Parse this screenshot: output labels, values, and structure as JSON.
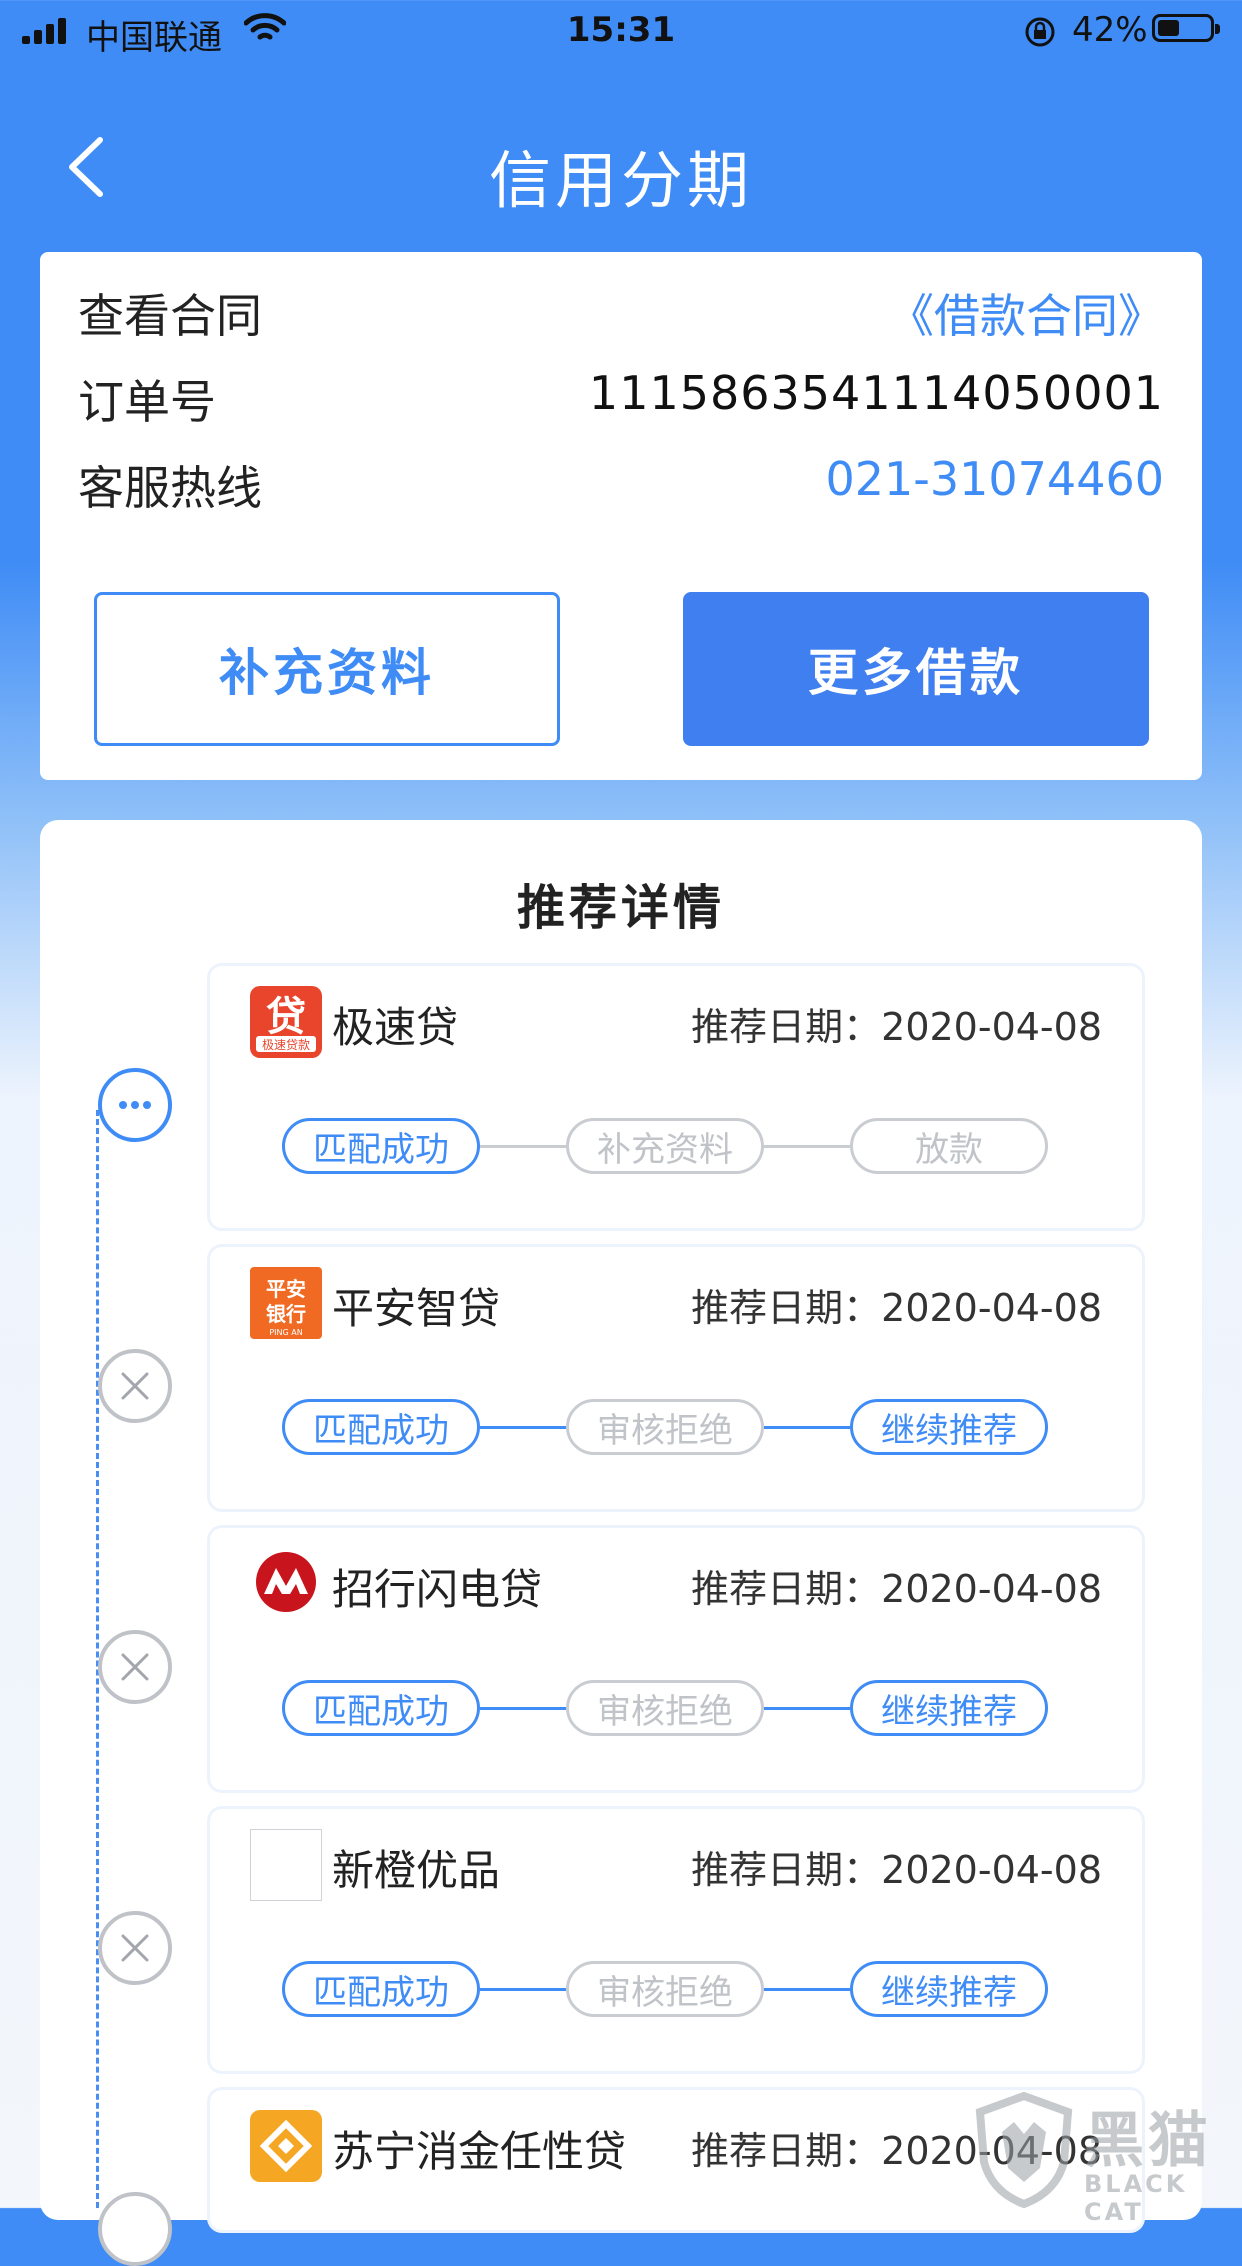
{
  "status_bar": {
    "carrier": "中国联通",
    "time": "15:31",
    "battery_percent": "42%",
    "battery_level": 0.42
  },
  "nav": {
    "back_icon": "chevron-left-icon",
    "title": "信用分期"
  },
  "info": {
    "contract_label": "查看合同",
    "contract_link": "《借款合同》",
    "order_label": "订单号",
    "order_number": "1115863541114050001",
    "hotline_label": "客服热线",
    "hotline_number": "021-31074460",
    "supplement_button": "补充资料",
    "more_loans_button": "更多借款"
  },
  "recommend": {
    "title": "推荐详情",
    "items": [
      {
        "name": "极速贷",
        "logo_icon": "jisudai-logo-icon",
        "logo_text": "贷",
        "logo_subtext": "极速贷款",
        "date": "推荐日期：2020-04-08",
        "node_icon": "pending-dots-icon",
        "steps": [
          "匹配成功",
          "补充资料",
          "放款"
        ]
      },
      {
        "name": "平安智贷",
        "logo_icon": "pingan-bank-logo-icon",
        "logo_text": "平安银行",
        "logo_subtext": "PING AN",
        "date": "推荐日期：2020-04-08",
        "node_icon": "rejected-x-icon",
        "steps": [
          "匹配成功",
          "审核拒绝",
          "继续推荐"
        ]
      },
      {
        "name": "招行闪电贷",
        "logo_icon": "cmb-logo-icon",
        "date": "推荐日期：2020-04-08",
        "node_icon": "rejected-x-icon",
        "steps": [
          "匹配成功",
          "审核拒绝",
          "继续推荐"
        ]
      },
      {
        "name": "新橙优品",
        "logo_icon": "blank-logo-icon",
        "date": "推荐日期：2020-04-08",
        "node_icon": "rejected-x-icon",
        "steps": [
          "匹配成功",
          "审核拒绝",
          "继续推荐"
        ]
      },
      {
        "name": "苏宁消金任性贷",
        "logo_icon": "suning-logo-icon",
        "date": "推荐日期：2020-04-08",
        "node_icon": "rejected-x-icon",
        "steps": []
      }
    ]
  },
  "watermark": {
    "text": "黑猫",
    "subtext": "BLACK CAT"
  },
  "colors": {
    "accent": "#3f8cf6",
    "button_solid": "#3f7ff0",
    "inactive": "#c0c3c8",
    "logo_red": "#e8452c",
    "logo_orange": "#f5a623"
  }
}
